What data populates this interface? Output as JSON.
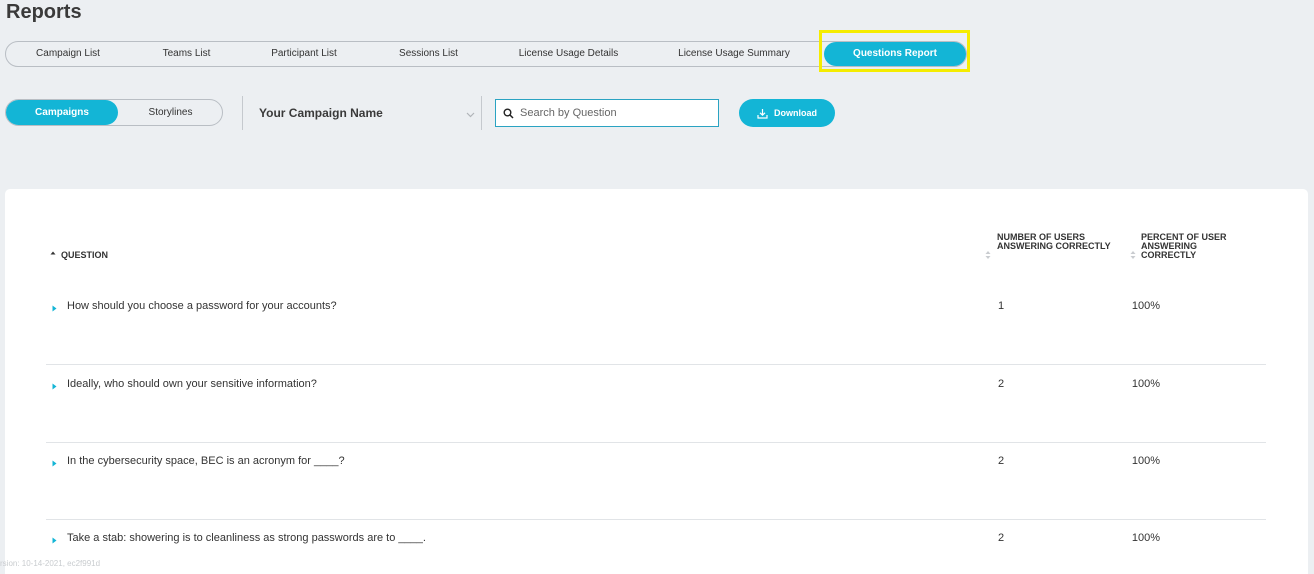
{
  "page": {
    "title": "Reports"
  },
  "tabs": [
    {
      "label": "Campaign List"
    },
    {
      "label": "Teams List"
    },
    {
      "label": "Participant List"
    },
    {
      "label": "Sessions List"
    },
    {
      "label": "License Usage Details"
    },
    {
      "label": "License Usage Summary"
    },
    {
      "label": "Questions Report",
      "active": true
    }
  ],
  "toggle": {
    "campaigns_label": "Campaigns",
    "storylines_label": "Storylines"
  },
  "campaign_select": {
    "value": "Your Campaign Name"
  },
  "search": {
    "placeholder": "Search by Question",
    "value": ""
  },
  "download": {
    "label": "Download"
  },
  "table": {
    "headers": {
      "question": "Question",
      "number_users": "Number of users answering correctly",
      "percent_users": "Percent of user answering correctly"
    },
    "rows": [
      {
        "question": "How should you choose a password for your accounts?",
        "number": "1",
        "percent": "100%"
      },
      {
        "question": "Ideally, who should own your sensitive information?",
        "number": "2",
        "percent": "100%"
      },
      {
        "question": "In the cybersecurity space, BEC is an acronym for ____?",
        "number": "2",
        "percent": "100%"
      },
      {
        "question": "Take a stab: showering is to cleanliness as strong passwords are to ____.",
        "number": "2",
        "percent": "100%"
      }
    ]
  },
  "footer": {
    "version": "rsion: 10-14-2021, ec2f991d"
  },
  "colors": {
    "accent": "#13b5d6",
    "highlight": "#f5ec00",
    "background": "#eceff2"
  }
}
